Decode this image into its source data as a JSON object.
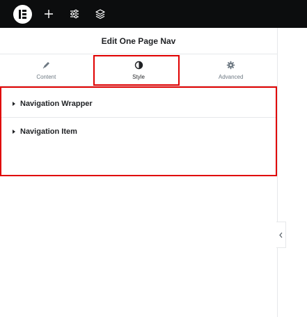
{
  "topbar": {
    "logo": "elementor-logo",
    "icons": [
      "add-icon",
      "sliders-icon",
      "layers-icon"
    ],
    "background": "#0c0d0e"
  },
  "panel": {
    "title": "Edit One Page Nav",
    "tabs": [
      {
        "label": "Content",
        "icon": "pencil-icon",
        "active": false
      },
      {
        "label": "Style",
        "icon": "half-circle-icon",
        "active": true
      },
      {
        "label": "Advanced",
        "icon": "gear-icon",
        "active": false
      }
    ],
    "sections": [
      {
        "label": "Navigation Wrapper"
      },
      {
        "label": "Navigation Item"
      }
    ]
  },
  "colors": {
    "highlight": "#e00000",
    "divider": "#e6e8ea",
    "text": "#1f2124",
    "muted": "#6d7882"
  }
}
